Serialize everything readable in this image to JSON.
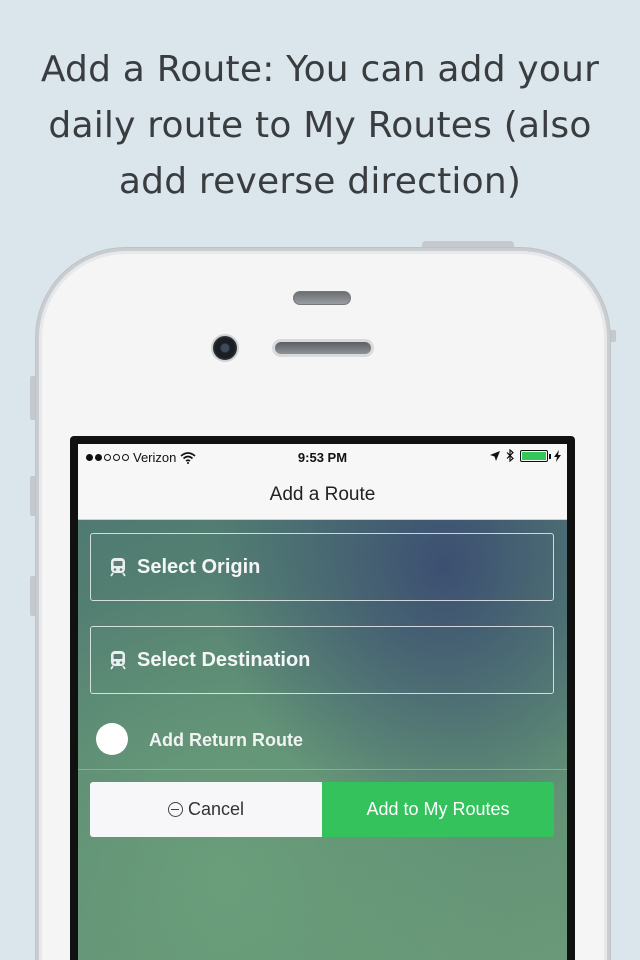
{
  "headline": {
    "line1": "Add a Route: You can add your",
    "line2": "daily route to My Routes (also",
    "line3": "add reverse direction)"
  },
  "status_bar": {
    "carrier": "Verizon",
    "time": "9:53 PM",
    "signal_dots": 2,
    "battery_color": "#35c759",
    "icons": [
      "wifi-icon",
      "location-arrow-icon",
      "bluetooth-icon",
      "battery-icon",
      "charging-bolt-icon"
    ]
  },
  "nav": {
    "title": "Add a Route"
  },
  "form": {
    "origin_label": "Select Origin",
    "destination_label": "Select Destination",
    "return_route_label": "Add Return Route",
    "field_icon": "train-icon"
  },
  "actions": {
    "cancel_label": "Cancel",
    "add_label": "Add to My Routes",
    "add_color": "#34c25c"
  }
}
